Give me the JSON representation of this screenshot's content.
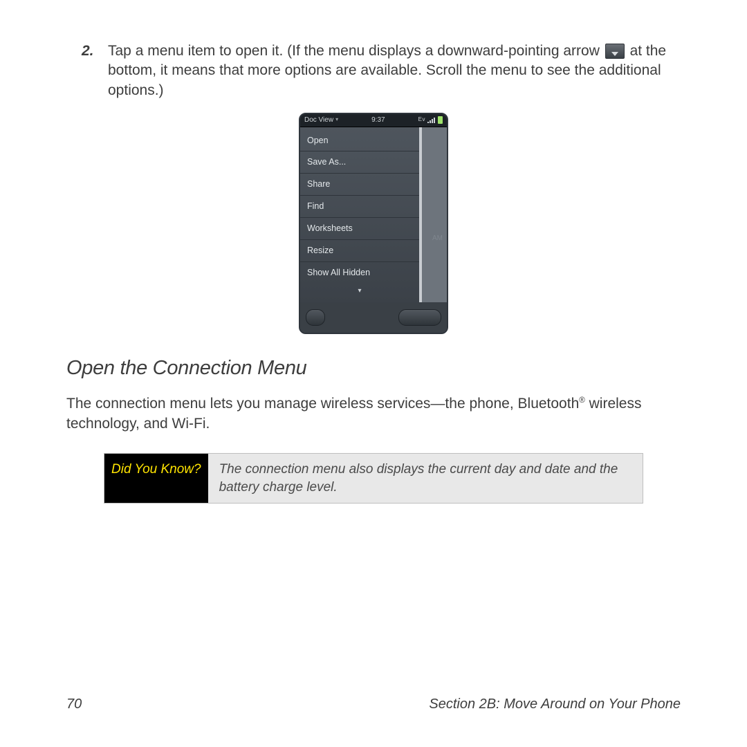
{
  "step": {
    "number": "2.",
    "text_a": "Tap a menu item to open it. (If the menu displays a downward-pointing arrow ",
    "text_b": " at the bottom, it means that more options are available. Scroll the menu to see the additional options.)"
  },
  "phone": {
    "statusbar": {
      "app_name": "Doc View",
      "time": "9:37",
      "network": "Ev"
    },
    "menu_items": [
      "Open",
      "Save As...",
      "Share",
      "Find",
      "Worksheets",
      "Resize",
      "Show All Hidden"
    ],
    "behind_labels": {
      "label1": "AM"
    },
    "more_glyph": "▾"
  },
  "section": {
    "heading": "Open the Connection Menu",
    "para_a": "The connection menu lets you manage wireless services—the phone, Bluetooth",
    "reg": "®",
    "para_b": " wireless technology, and Wi-Fi."
  },
  "callout": {
    "label": "Did You Know?",
    "body": "The connection menu also displays the current day and date and the battery charge level."
  },
  "footer": {
    "page": "70",
    "section": "Section 2B: Move Around on Your Phone"
  }
}
